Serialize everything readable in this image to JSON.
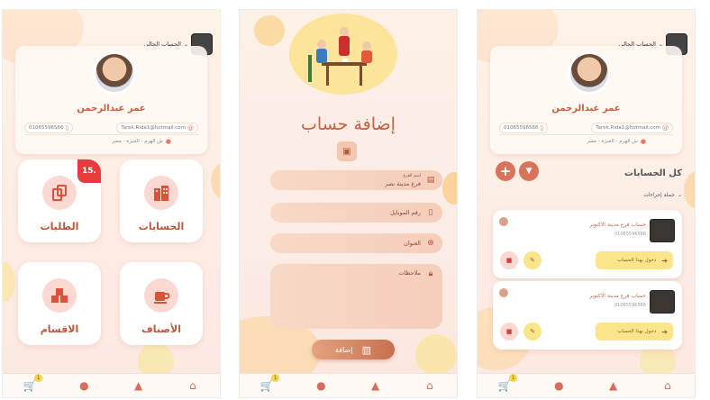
{
  "screen1": {
    "account_switch": "الحساب الحالي",
    "profile": {
      "name": "عمر عبدالرحمن",
      "phone": "01065596566",
      "email": "Tarek.Rida1@hotmail.com",
      "address": "ش الهرم - الجيزة - مصر"
    },
    "tiles": [
      {
        "label": "الحسابات",
        "icon": "building-icon"
      },
      {
        "label": "الطلبات",
        "icon": "order-icon",
        "badge": "15."
      },
      {
        "label": "الأصناف",
        "icon": "cup-icon"
      },
      {
        "label": "الاقسام",
        "icon": "cubes-icon"
      }
    ],
    "nav_badge": "1"
  },
  "screen2": {
    "title": "إضافة حساب",
    "fields": {
      "branch_label": "اسم الفرع",
      "branch_value": "فرع مدينة نصر",
      "mobile_placeholder": "رقم الموبايل",
      "address_placeholder": "العنوان",
      "notes_placeholder": "ملاحظات"
    },
    "submit_label": "إضافة",
    "nav_badge": "1"
  },
  "screen3": {
    "account_switch": "الحساب الحالي",
    "profile": {
      "name": "عمر عبدالرحمن",
      "phone": "01065596566",
      "email": "Tarek.Rida1@hotmail.com",
      "address": "ش الهرم - الجيزة - مصر"
    },
    "section_title": "كل الحسابات",
    "bulk_actions": "جملة إجراءات",
    "accounts": [
      {
        "name": "حساب فرع مدينة الاكتوبر",
        "phone": "01065596566",
        "login": "دخول بهذا الحساب"
      },
      {
        "name": "حساب فرع مدينة الاكتوبر",
        "phone": "01065596566",
        "login": "دخول بهذا الحساب"
      }
    ],
    "nav_badge": "1"
  },
  "colors": {
    "accent": "#c6603f",
    "tile_circle": "#fbd8d2",
    "badge": "#e63b3b",
    "login_btn": "#fbe58a"
  }
}
